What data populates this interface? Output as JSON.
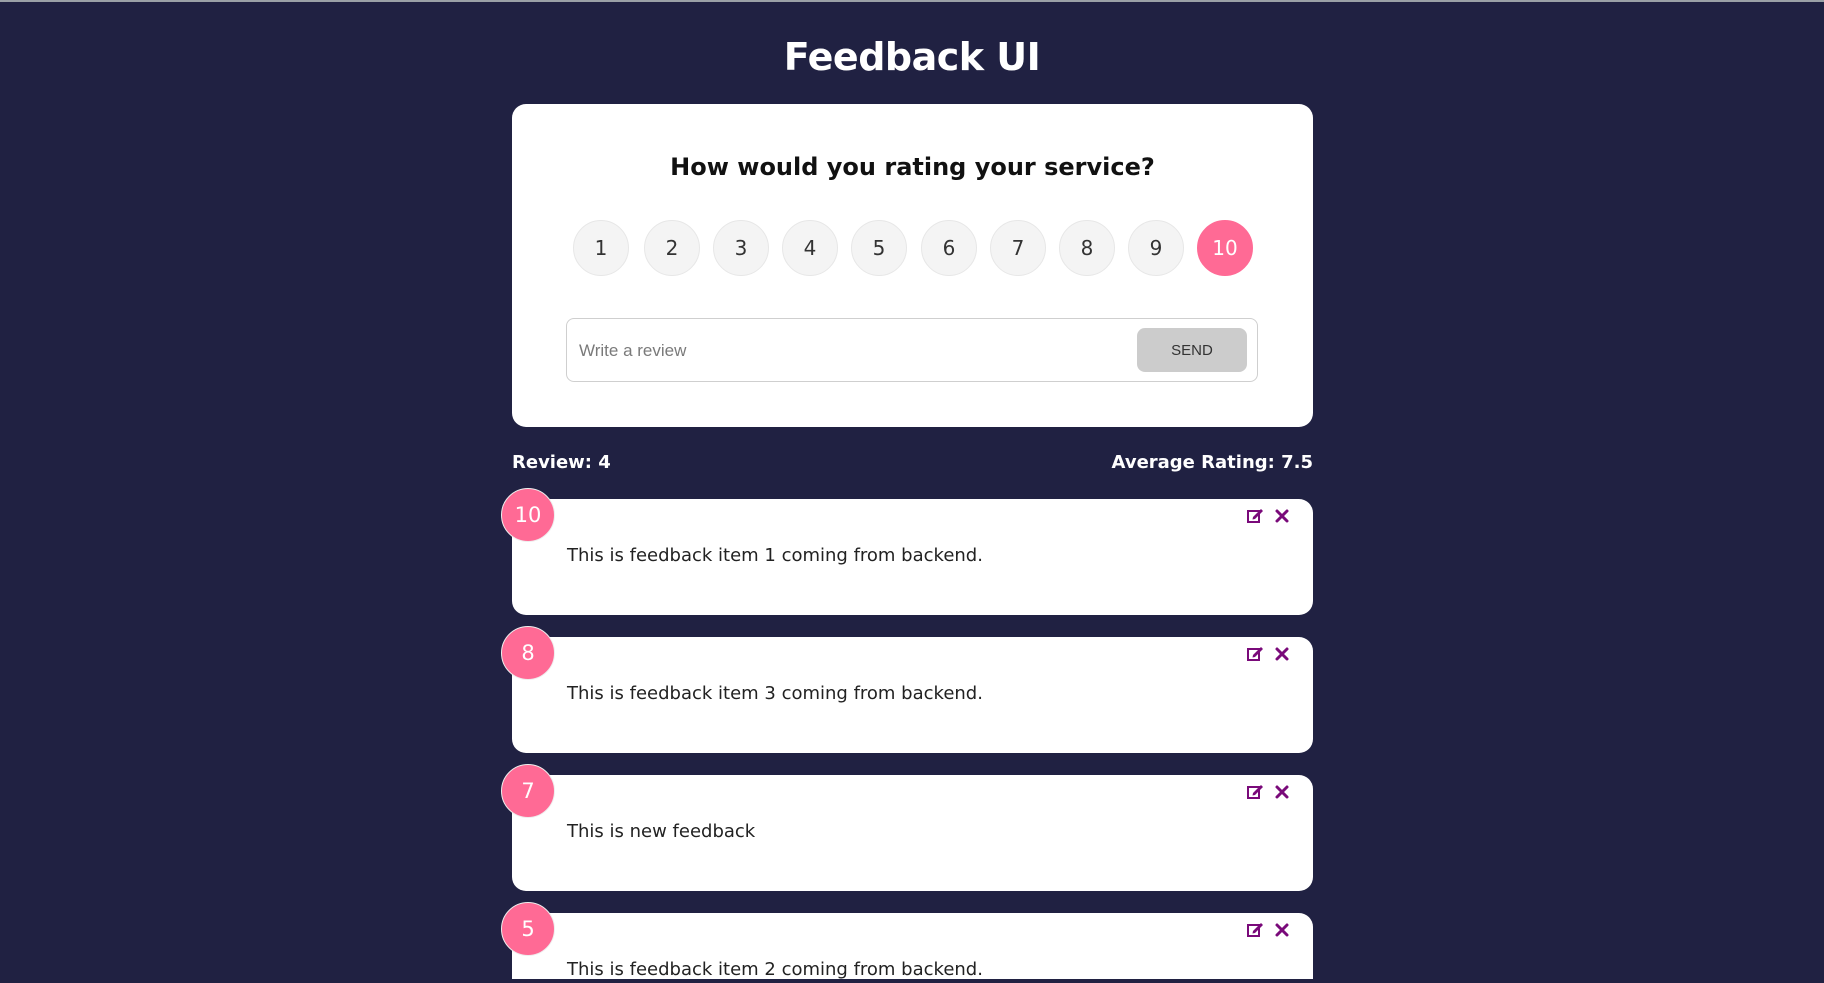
{
  "header": {
    "title": "Feedback UI"
  },
  "rating_form": {
    "question": "How would you rating your service?",
    "ratings": [
      "1",
      "2",
      "3",
      "4",
      "5",
      "6",
      "7",
      "8",
      "9",
      "10"
    ],
    "selected": "10",
    "review_placeholder": "Write a review",
    "review_value": "",
    "send_label": "SEND"
  },
  "stats": {
    "review_count": "Review: 4",
    "average_rating": "Average Rating: 7.5"
  },
  "feedback": [
    {
      "rating": "10",
      "text": "This is feedback item 1 coming from backend."
    },
    {
      "rating": "8",
      "text": "This is feedback item 3 coming from backend."
    },
    {
      "rating": "7",
      "text": "This is new feedback"
    },
    {
      "rating": "5",
      "text": "This is feedback item 2 coming from backend."
    }
  ],
  "icons": {
    "edit": "edit-icon",
    "close": "close-icon"
  },
  "colors": {
    "background": "#202142",
    "accent": "#ff6a95",
    "icon": "#7a0a7a",
    "card": "#ffffff"
  }
}
